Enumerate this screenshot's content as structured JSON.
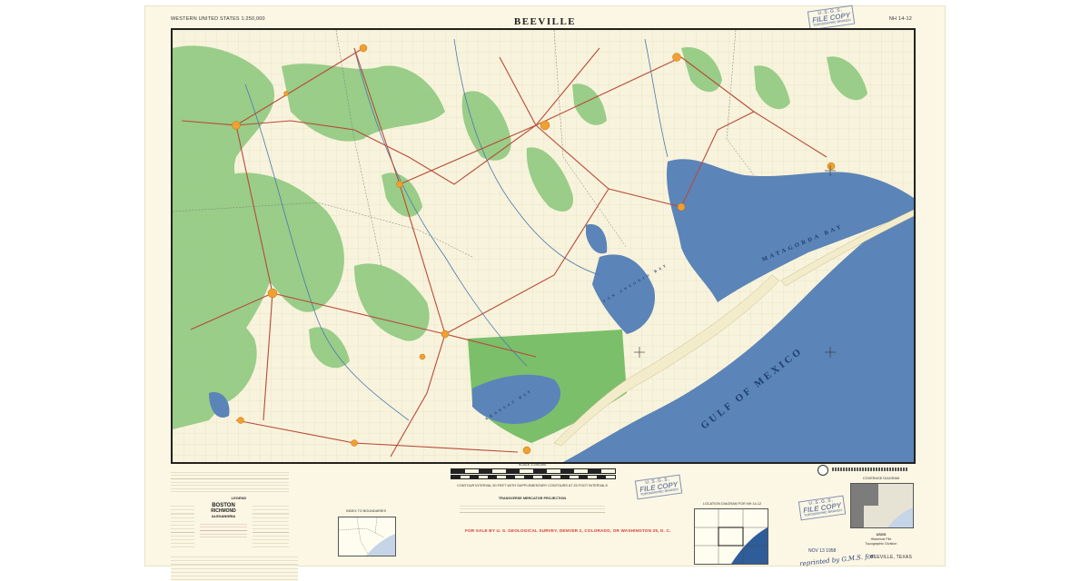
{
  "sheet": {
    "series_label": "WESTERN UNITED STATES 1:250,000",
    "title": "BEEVILLE",
    "sheet_number": "NH 14-12",
    "footer_name": "BEEVILLE, TEXAS",
    "sale_notice": "FOR SALE BY U. S. GEOLOGICAL SURVEY, DENVER 2, COLORADO, OR WASHINGTON 25, D. C."
  },
  "stamps": {
    "agency": "U.S.G.S.",
    "main": "FILE COPY",
    "sub": "TOPOGRAPHIC BRANCH"
  },
  "map": {
    "water_labels": [
      "GULF OF MEXICO",
      "MATAGORDA BAY",
      "SAN ANTONIO BAY",
      "ARANSAS BAY"
    ],
    "colors": {
      "land": "#f8f3dc",
      "woodland": "#8fc980",
      "water": "#5b84b8",
      "road": "#b84a3a",
      "town": "#f0a030",
      "frame": "#222222"
    }
  },
  "margin": {
    "legend_title": "LEGEND",
    "legend_towns": [
      "BOSTON",
      "RICHMOND",
      "ALEXANDRIA"
    ],
    "index_title": "INDEX TO BOUNDARIES",
    "location_title": "LOCATION DIAGRAM FOR NH 14-12",
    "coverage_title": "COVERAGE DIAGRAM",
    "contour_note": "CONTOUR INTERVAL 50 FEET WITH SUPPLEMENTARY CONTOURS AT 25 FOOT INTERVALS",
    "projection_note": "TRANSVERSE MERCATOR PROJECTION",
    "scale_label": "SCALE 1:250,000",
    "archive_note": [
      "USGS",
      "Historical File",
      "Topographic Division"
    ],
    "date_stamp": "NOV 13 1958",
    "handwritten": "reprinted by G.M.S. for"
  },
  "icons": [
    "usgs-seal-icon",
    "compass-crosshair-icon"
  ]
}
